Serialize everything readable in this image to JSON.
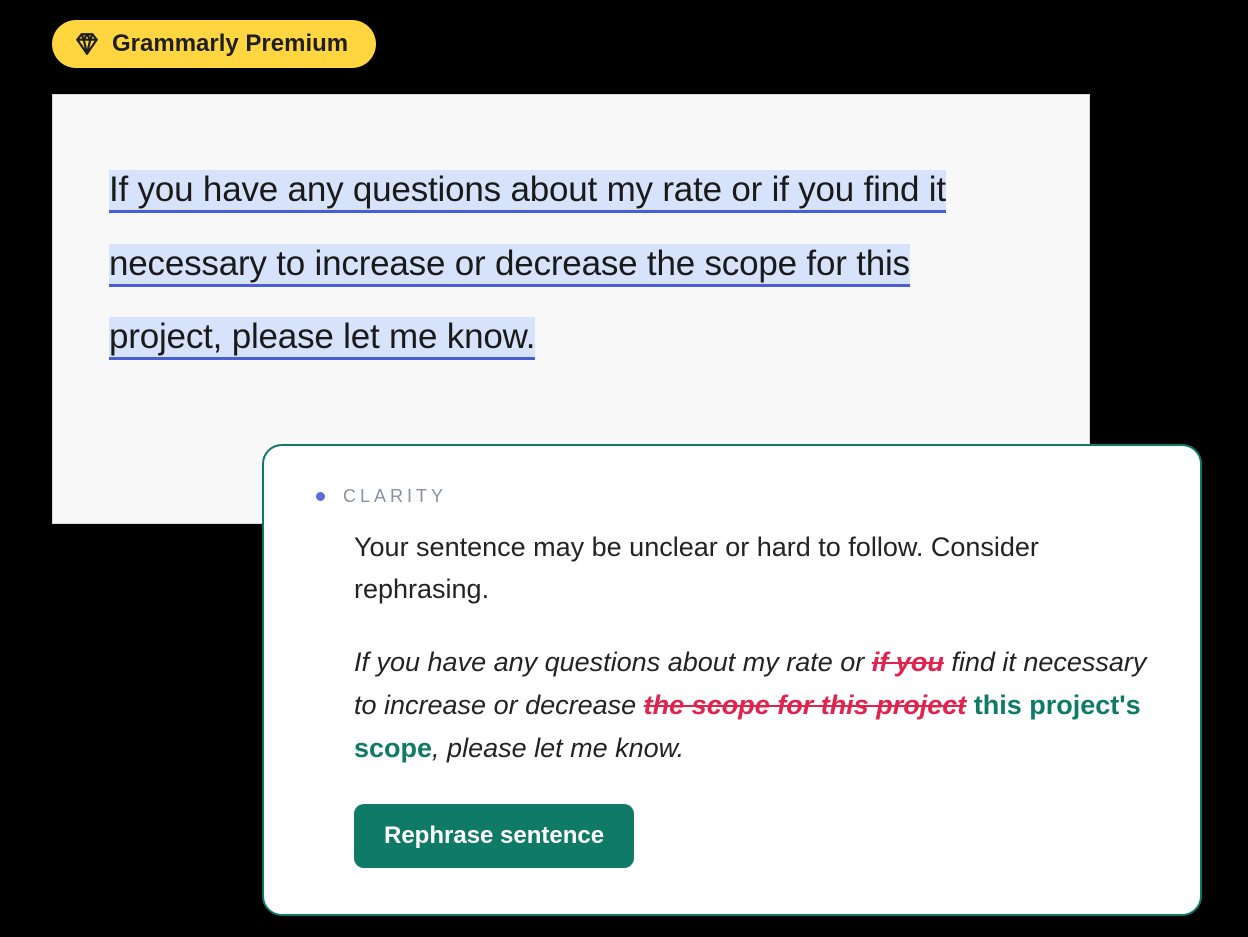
{
  "badge": {
    "label": "Grammarly Premium",
    "icon": "diamond-icon"
  },
  "editor": {
    "sentence": "If you have any questions about my rate or if you find it necessary to increase or decrease the scope for this project, please let me know."
  },
  "suggestion": {
    "category": "CLARITY",
    "explanation": "Your sentence may be unclear or hard to follow. Consider rephrasing.",
    "rewrite": {
      "seg1": "If you have any questions about my rate or ",
      "strike1": "if you",
      "seg2": " find it necessary to increase or decrease ",
      "strike2": "the scope for this project",
      "insert": " this project's scope",
      "seg3": ", please let me know."
    },
    "cta": "Rephrase sentence"
  },
  "colors": {
    "accent_yellow": "#FFD63F",
    "brand_green": "#0f7a65",
    "highlight_bg": "#d6e3fb",
    "highlight_underline": "#4a5cd6",
    "strike_red": "#e0244d"
  }
}
